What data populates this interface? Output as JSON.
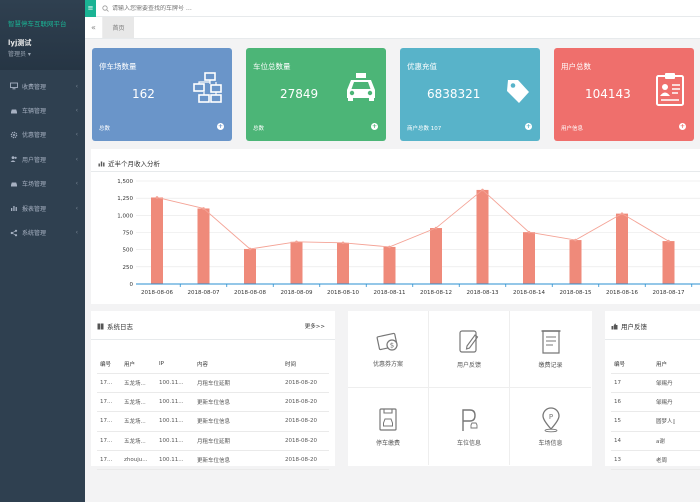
{
  "sidebar": {
    "brand": "智慧停车互联网平台",
    "user": "lyj测试",
    "role": "管理员 ▾",
    "items": [
      {
        "label": "收费管理",
        "icon": "monitor-icon"
      },
      {
        "label": "车辆管理",
        "icon": "car-icon"
      },
      {
        "label": "优惠管理",
        "icon": "gear-icon"
      },
      {
        "label": "用户管理",
        "icon": "users-icon"
      },
      {
        "label": "车场管理",
        "icon": "parking-icon"
      },
      {
        "label": "报表管理",
        "icon": "chart-icon"
      },
      {
        "label": "系统管理",
        "icon": "share-icon"
      }
    ]
  },
  "topbar": {
    "search_placeholder": "请输入您需要查找的车牌号 …"
  },
  "tabs": {
    "nav": "«",
    "home": "首页"
  },
  "cards": [
    {
      "title": "停车场数量",
      "value": "162",
      "foot": "总数",
      "color": "#6a95c9",
      "icon": "network-icon"
    },
    {
      "title": "车位总数量",
      "value": "27849",
      "foot": "总数",
      "color": "#4cb577",
      "icon": "taxi-icon"
    },
    {
      "title": "优惠充值",
      "value": "6838321",
      "foot": "商户总数  107",
      "color": "#58b3c9",
      "icon": "tag-icon"
    },
    {
      "title": "用户总数",
      "value": "104143",
      "foot": "用户信息",
      "color": "#ef6f6c",
      "icon": "id-card-icon"
    }
  ],
  "chart_panel": {
    "title": "近半个月收入分析"
  },
  "chart_data": {
    "type": "bar",
    "title": "近半个月收入分析",
    "categories": [
      "2018-08-06",
      "2018-08-07",
      "2018-08-08",
      "2018-08-09",
      "2018-08-10",
      "2018-08-11",
      "2018-08-12",
      "2018-08-13",
      "2018-08-14",
      "2018-08-15",
      "2018-08-16",
      "2018-08-17"
    ],
    "values": [
      1260,
      1100,
      510,
      615,
      600,
      540,
      815,
      1370,
      755,
      640,
      1025,
      625
    ],
    "line_values": [
      1260,
      1100,
      510,
      615,
      600,
      540,
      815,
      1370,
      755,
      640,
      1025,
      625
    ],
    "yticks": [
      "0",
      "250",
      "500",
      "750",
      "1,000",
      "1,250",
      "1,500"
    ],
    "ylim": [
      0,
      1500
    ],
    "bar_color": "#ef8a7a",
    "line_color": "#f4a396"
  },
  "log_panel": {
    "title": "系统日志",
    "more": "更多>>",
    "columns": [
      "编号",
      "用户",
      "IP",
      "内容",
      "时间"
    ],
    "rows": [
      [
        "17...",
        "五龙场...",
        "100.11...",
        "月租车位延期",
        "2018-08-20"
      ],
      [
        "17...",
        "五龙场...",
        "100.11...",
        "更新车位信息",
        "2018-08-20"
      ],
      [
        "17...",
        "五龙场...",
        "100.11...",
        "更新车位信息",
        "2018-08-20"
      ],
      [
        "17...",
        "五龙场...",
        "100.11...",
        "月租车位延期",
        "2018-08-20"
      ],
      [
        "17...",
        "zhouju...",
        "100.11...",
        "更新车位信息",
        "2018-08-20"
      ]
    ]
  },
  "quick_grid": [
    {
      "label": "优惠券方案",
      "icon": "coupon-icon"
    },
    {
      "label": "用户反馈",
      "icon": "feedback-icon"
    },
    {
      "label": "缴费记录",
      "icon": "receipt-icon"
    },
    {
      "label": "停车缴费",
      "icon": "parking-pay-icon"
    },
    {
      "label": "车位信息",
      "icon": "parking-spot-icon"
    },
    {
      "label": "车场信息",
      "icon": "location-icon"
    }
  ],
  "feedback_panel": {
    "title": "用户反馈",
    "columns": [
      "编号",
      "用户"
    ],
    "rows": [
      [
        "17",
        "邹赐丹"
      ],
      [
        "16",
        "邹赐丹"
      ],
      [
        "15",
        "圆梦人▯"
      ],
      [
        "14",
        "a谢"
      ],
      [
        "13",
        "老周"
      ]
    ]
  }
}
